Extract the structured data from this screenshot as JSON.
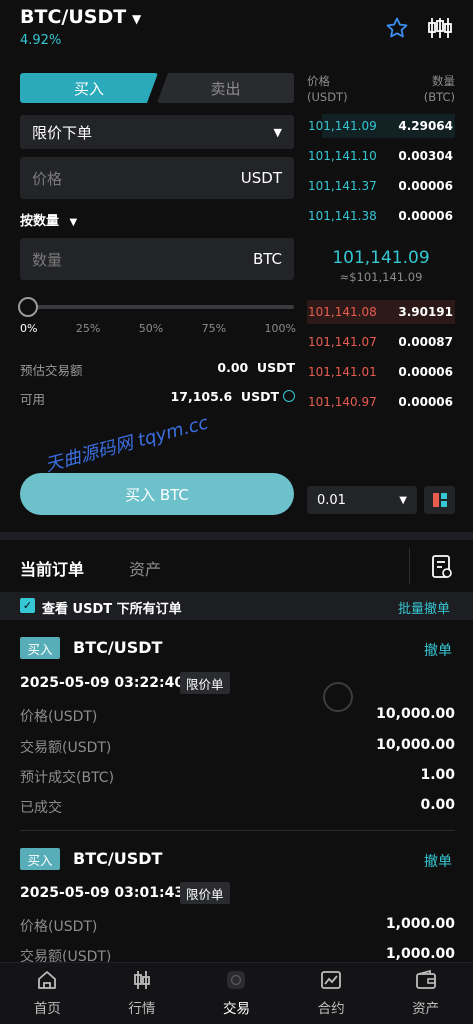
{
  "header": {
    "pair": "BTC/USDT",
    "change": "4.92%"
  },
  "trade": {
    "buy_tab": "买入",
    "sell_tab": "卖出",
    "order_type": "限价下单",
    "price_placeholder": "价格",
    "price_unit": "USDT",
    "qty_mode": "按数量",
    "qty_placeholder": "数量",
    "qty_unit": "BTC",
    "slider_labels": [
      "0%",
      "25%",
      "50%",
      "75%",
      "100%"
    ],
    "slider_level_percent": 0,
    "est_label": "预估交易额",
    "est_value": "0.00  USDT",
    "avail_label": "可用",
    "avail_value": "17,105.6  USDT",
    "buy_button": "买入 BTC"
  },
  "orderbook": {
    "price_head": "价格",
    "price_unit": "(USDT)",
    "qty_head": "数量",
    "qty_unit": "(BTC)",
    "asks": [
      {
        "price": "101,141.09",
        "qty": "4.29064",
        "depth": 0.9
      },
      {
        "price": "101,141.10",
        "qty": "0.00304",
        "depth": 0.0
      },
      {
        "price": "101,141.37",
        "qty": "0.00006",
        "depth": 0.0
      },
      {
        "price": "101,141.38",
        "qty": "0.00006",
        "depth": 0.0
      }
    ],
    "mid_price": "101,141.09",
    "mid_fiat": "≈$101,141.09",
    "bids": [
      {
        "price": "101,141.08",
        "qty": "3.90191",
        "depth": 1.0
      },
      {
        "price": "101,141.07",
        "qty": "0.00087",
        "depth": 0.0
      },
      {
        "price": "101,141.01",
        "qty": "0.00006",
        "depth": 0.0
      },
      {
        "price": "101,140.97",
        "qty": "0.00006",
        "depth": 0.0
      }
    ],
    "depth_value": "0.01"
  },
  "watermark": "天曲源码网 tqym.cc",
  "orders_section": {
    "tab_orders": "当前订单",
    "tab_assets": "资产",
    "filter_label": "查看 USDT 下所有订单",
    "cancel_all": "批量撤单",
    "orders": [
      {
        "side": "买入",
        "pair": "BTC/USDT",
        "cancel": "撤单",
        "time": "2025-05-09 03:22:40",
        "tag": "限价单",
        "rows": [
          {
            "k": "价格(USDT)",
            "v": "10,000.00"
          },
          {
            "k": "交易额(USDT)",
            "v": "10,000.00"
          },
          {
            "k": "预计成交(BTC)",
            "v": "1.00"
          },
          {
            "k": "已成交",
            "v": "0.00"
          }
        ]
      },
      {
        "side": "买入",
        "pair": "BTC/USDT",
        "cancel": "撤单",
        "time": "2025-05-09 03:01:43",
        "tag": "限价单",
        "rows": [
          {
            "k": "价格(USDT)",
            "v": "1,000.00"
          },
          {
            "k": "交易额(USDT)",
            "v": "1,000.00"
          }
        ]
      }
    ]
  },
  "nav": [
    {
      "label": "首页",
      "icon": "home-icon"
    },
    {
      "label": "行情",
      "icon": "candlestick-icon"
    },
    {
      "label": "交易",
      "icon": "exchange-icon"
    },
    {
      "label": "合约",
      "icon": "chart-icon"
    },
    {
      "label": "资产",
      "icon": "wallet-icon"
    }
  ],
  "colors": {
    "accent": "#35c7d3",
    "sell": "#e85c4f",
    "background": "#0f0f10"
  }
}
